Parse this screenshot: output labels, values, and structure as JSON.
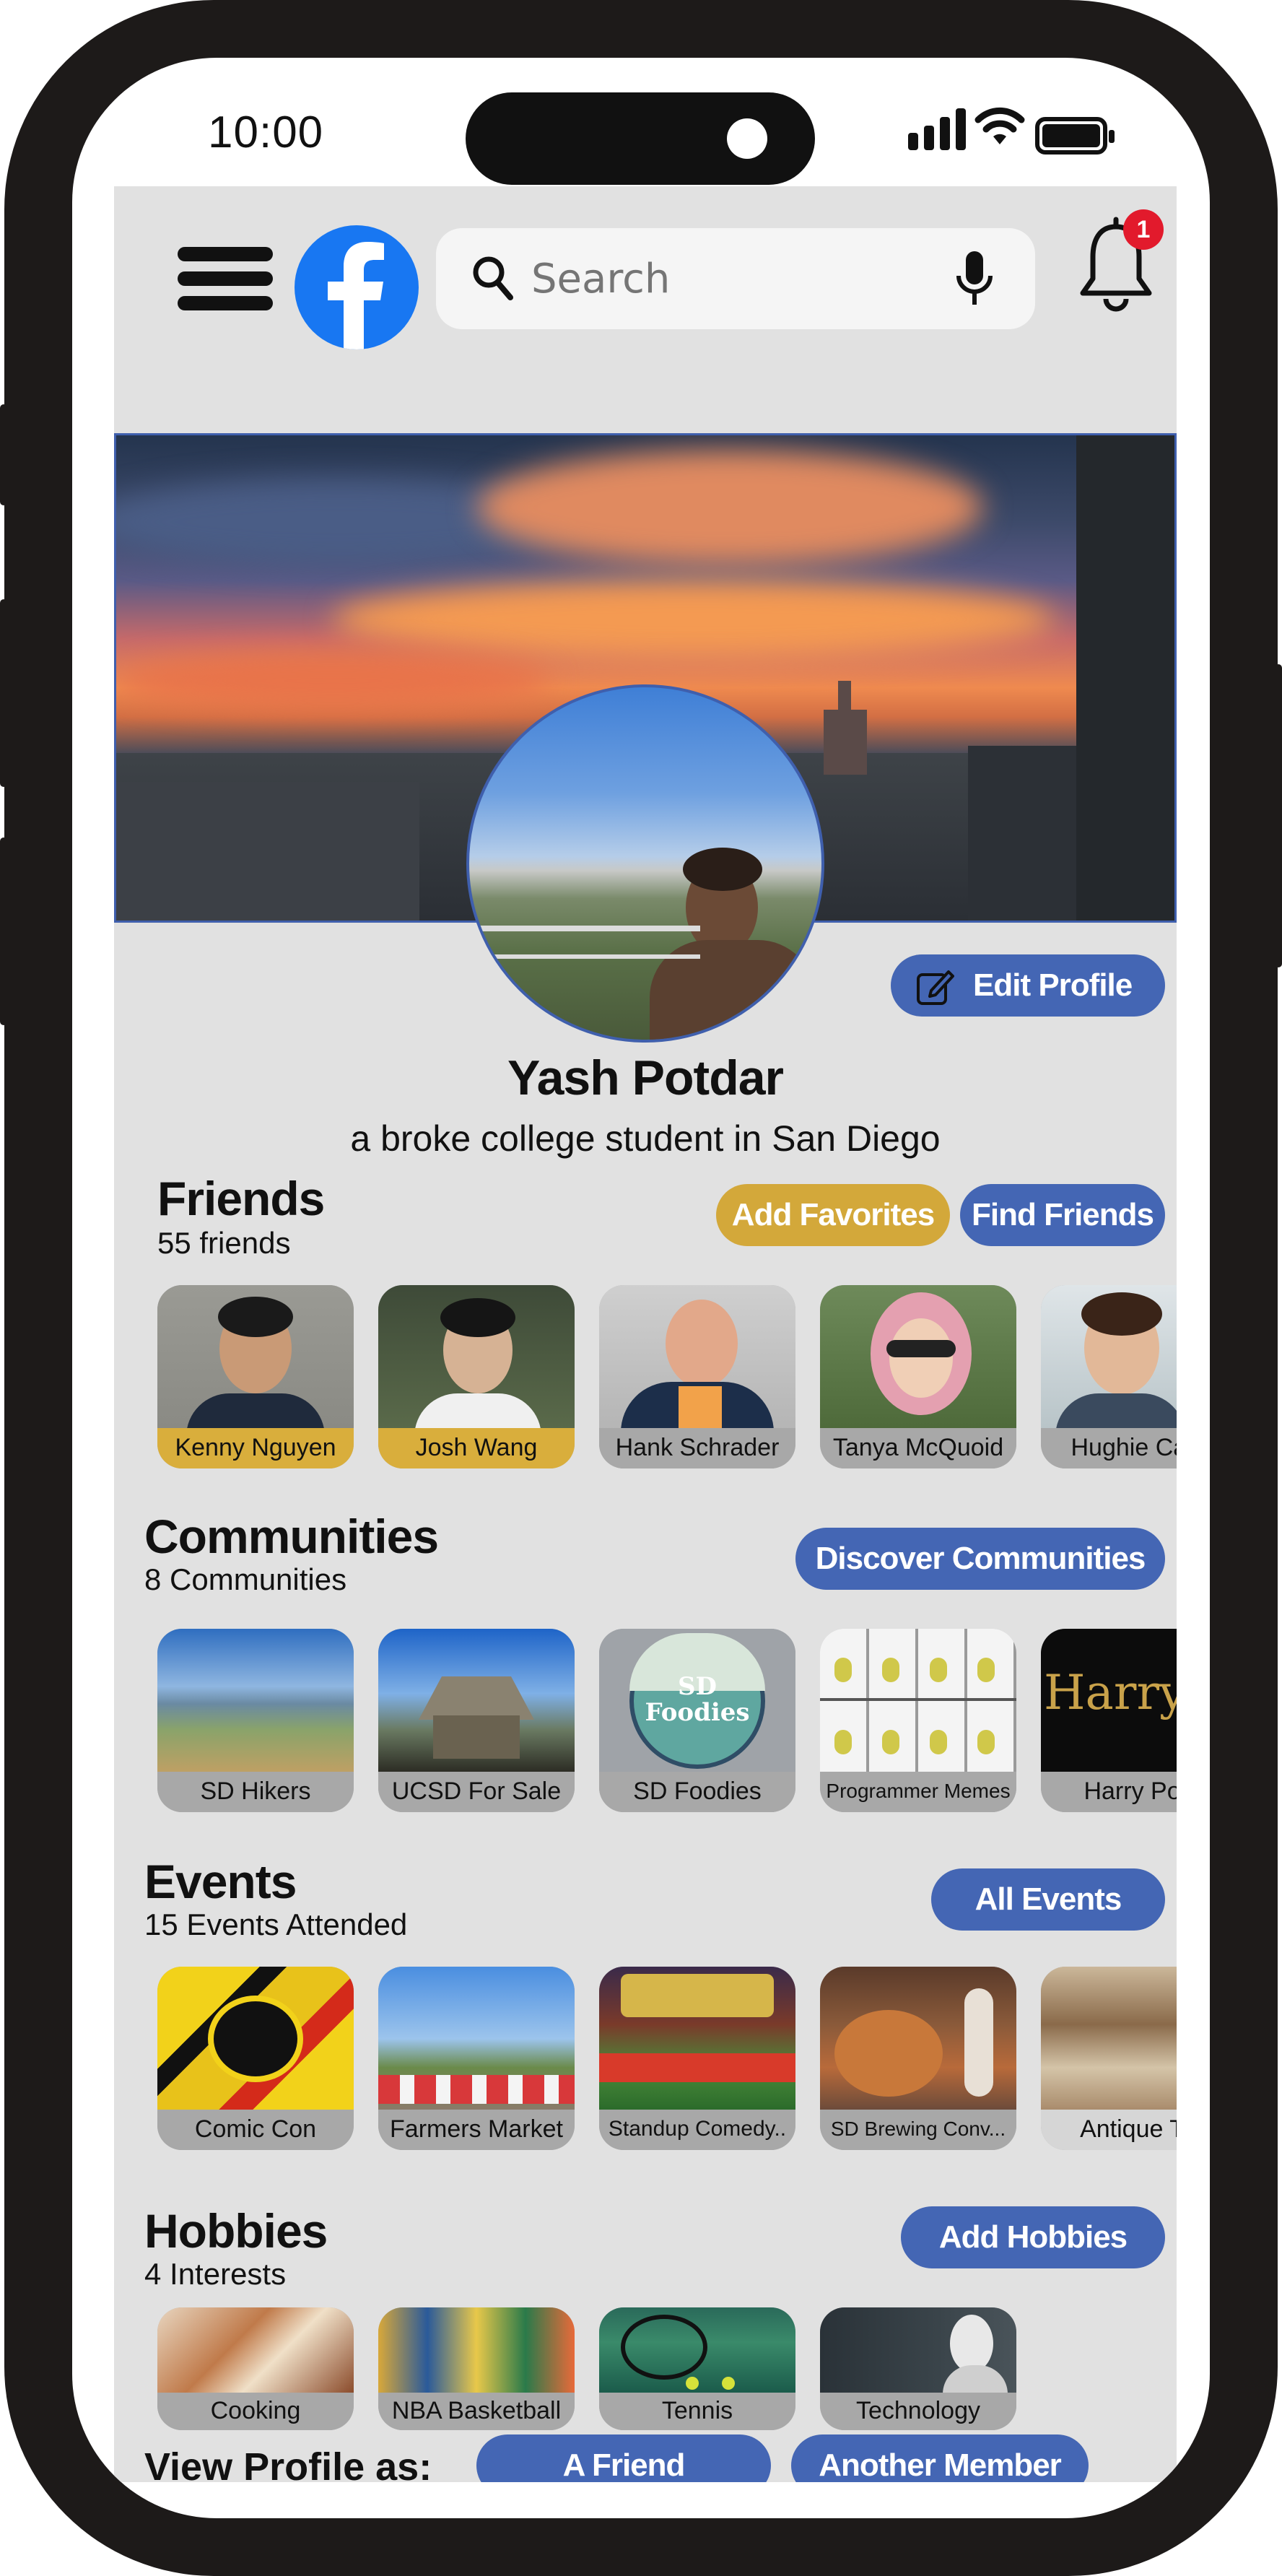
{
  "status_bar": {
    "time": "10:00"
  },
  "header": {
    "search_placeholder": "Search",
    "notification_count": "1"
  },
  "profile": {
    "name": "Yash Potdar",
    "bio": "a broke college student in San Diego",
    "edit_label": "Edit Profile"
  },
  "friends": {
    "title": "Friends",
    "count": "55 friends",
    "add_favorites": "Add Favorites",
    "find_friends": "Find Friends",
    "items": [
      {
        "label": "Kenny Nguyen",
        "favorite": true
      },
      {
        "label": "Josh Wang",
        "favorite": true
      },
      {
        "label": "Hank Schrader",
        "favorite": false
      },
      {
        "label": "Tanya McQuoid",
        "favorite": false
      },
      {
        "label": "Hughie Ca...",
        "favorite": false
      }
    ]
  },
  "communities": {
    "title": "Communities",
    "count": "8 Communities",
    "discover": "Discover Communities",
    "items": [
      {
        "label": "SD Hikers"
      },
      {
        "label": "UCSD For Sale"
      },
      {
        "label": "SD Foodies",
        "logo_text": "SD Foodies"
      },
      {
        "label": "Programmer Memes"
      },
      {
        "label": "Harry Po..",
        "logo_text": "Harry Po"
      }
    ]
  },
  "events": {
    "title": "Events",
    "count": "15 Events Attended",
    "all_events": "All Events",
    "items": [
      {
        "label": "Comic Con"
      },
      {
        "label": "Farmers Market"
      },
      {
        "label": "Standup Comedy.."
      },
      {
        "label": "SD Brewing Conv..."
      },
      {
        "label": "Antique Th"
      }
    ]
  },
  "hobbies": {
    "title": "Hobbies",
    "count": "4 Interests",
    "add_hobbies": "Add Hobbies",
    "items": [
      {
        "label": "Cooking"
      },
      {
        "label": "NBA Basketball"
      },
      {
        "label": "Tennis"
      },
      {
        "label": "Technology"
      }
    ]
  },
  "view_as": {
    "label": "View Profile as:",
    "friend": "A Friend",
    "member": "Another Member"
  },
  "colors": {
    "accent_blue": "#4466b4",
    "favorite_gold": "#d3a83a",
    "facebook_blue": "#1877f2",
    "badge_red": "#e21a2c",
    "screen_bg": "#e1e1e1"
  },
  "icons": [
    "menu-icon",
    "facebook-logo",
    "search-icon",
    "microphone-icon",
    "bell-icon",
    "edit-icon",
    "signal-icon",
    "wifi-icon",
    "battery-icon"
  ]
}
